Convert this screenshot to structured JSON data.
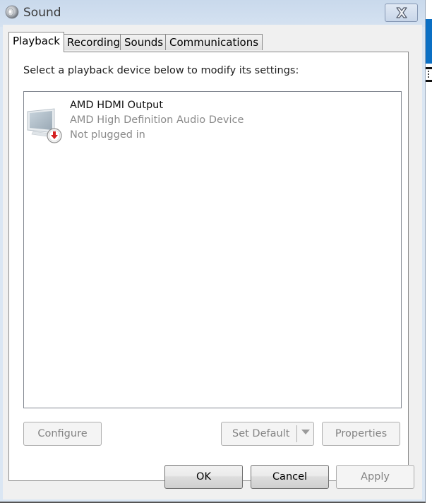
{
  "window": {
    "title": "Sound",
    "title_icon": "speaker-icon",
    "close_icon": "close-icon"
  },
  "tabs": [
    {
      "label": "Playback",
      "active": true
    },
    {
      "label": "Recording",
      "active": false
    },
    {
      "label": "Sounds",
      "active": false
    },
    {
      "label": "Communications",
      "active": false
    }
  ],
  "playback": {
    "instructions": "Select a playback device below to modify its settings:",
    "devices": [
      {
        "name": "AMD HDMI Output",
        "description": "AMD High Definition Audio Device",
        "status": "Not plugged in",
        "icon": "monitor-icon",
        "status_icon": "unplugged-arrow-icon"
      }
    ],
    "buttons": {
      "configure": "Configure",
      "set_default": "Set Default",
      "properties": "Properties"
    }
  },
  "dialog_buttons": {
    "ok": "OK",
    "cancel": "Cancel",
    "apply": "Apply"
  },
  "colors": {
    "titlebar": "#d5e2f1",
    "client_bg": "#f0f0f0",
    "disabled_text": "#838383",
    "unplugged_badge": "#d42020"
  }
}
